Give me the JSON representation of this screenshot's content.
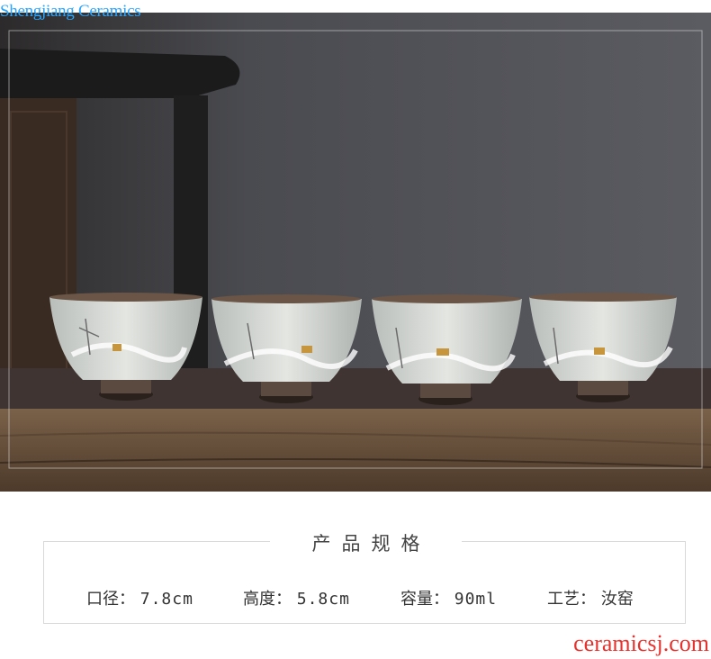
{
  "watermark_top": "Shengjiang Ceramics",
  "watermark_bottom": "ceramicsj.com",
  "spec": {
    "title": "产品规格",
    "diameter": "口径：",
    "diameter_value": "7.8cm",
    "height": "高度：",
    "height_value": "5.8cm",
    "capacity": "容量：",
    "capacity_value": "90ml",
    "craft": "工艺：",
    "craft_value": "汝窑"
  },
  "colors": {
    "wall": "#4e4f55",
    "table": "#6a5540",
    "cloth": "#3f3431",
    "cup_glaze": "#d8dcd8",
    "cup_foot": "#5a4a40",
    "watermark_blue": "#2aa6ff",
    "watermark_red": "#e8312c"
  }
}
